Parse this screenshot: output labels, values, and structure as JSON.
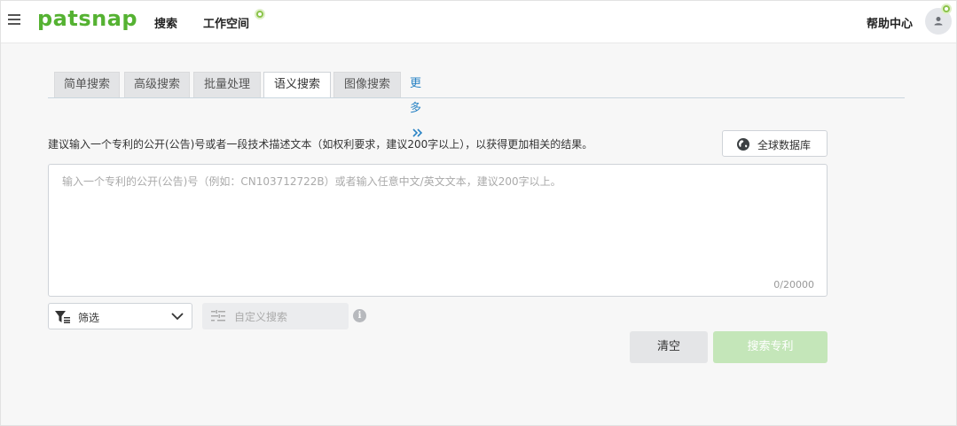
{
  "header": {
    "logo_text": "patsnap",
    "nav": {
      "search": "搜索",
      "workspace": "工作空间"
    },
    "help": "帮助中心"
  },
  "tabs": [
    {
      "label": "简单搜索",
      "active": false
    },
    {
      "label": "高级搜索",
      "active": false
    },
    {
      "label": "批量处理",
      "active": false
    },
    {
      "label": "语义搜索",
      "active": true
    },
    {
      "label": "图像搜索",
      "active": false
    }
  ],
  "more": {
    "label": "更多",
    "icon": "double-chevron-right-icon"
  },
  "main": {
    "description": "建议输入一个专利的公开(公告)号或者一段技术描述文本（如权利要求，建议200字以上），以获得更加相关的结果。",
    "db_button": "全球数据库",
    "textarea_placeholder": "输入一个专利的公开(公告)号（例如：CN103712722B）或者输入任意中文/英文文本，建议200字以上。",
    "counter": "0/20000",
    "filter_label": "筛选",
    "custom_search": "自定义搜索",
    "info": "i",
    "clear_button": "清空",
    "search_button": "搜索专利"
  },
  "colors": {
    "brand_green": "#55b232",
    "brand_blue": "#2b84c5",
    "search_button_bg": "#c4e6b9",
    "badge": "#8bc34a"
  }
}
